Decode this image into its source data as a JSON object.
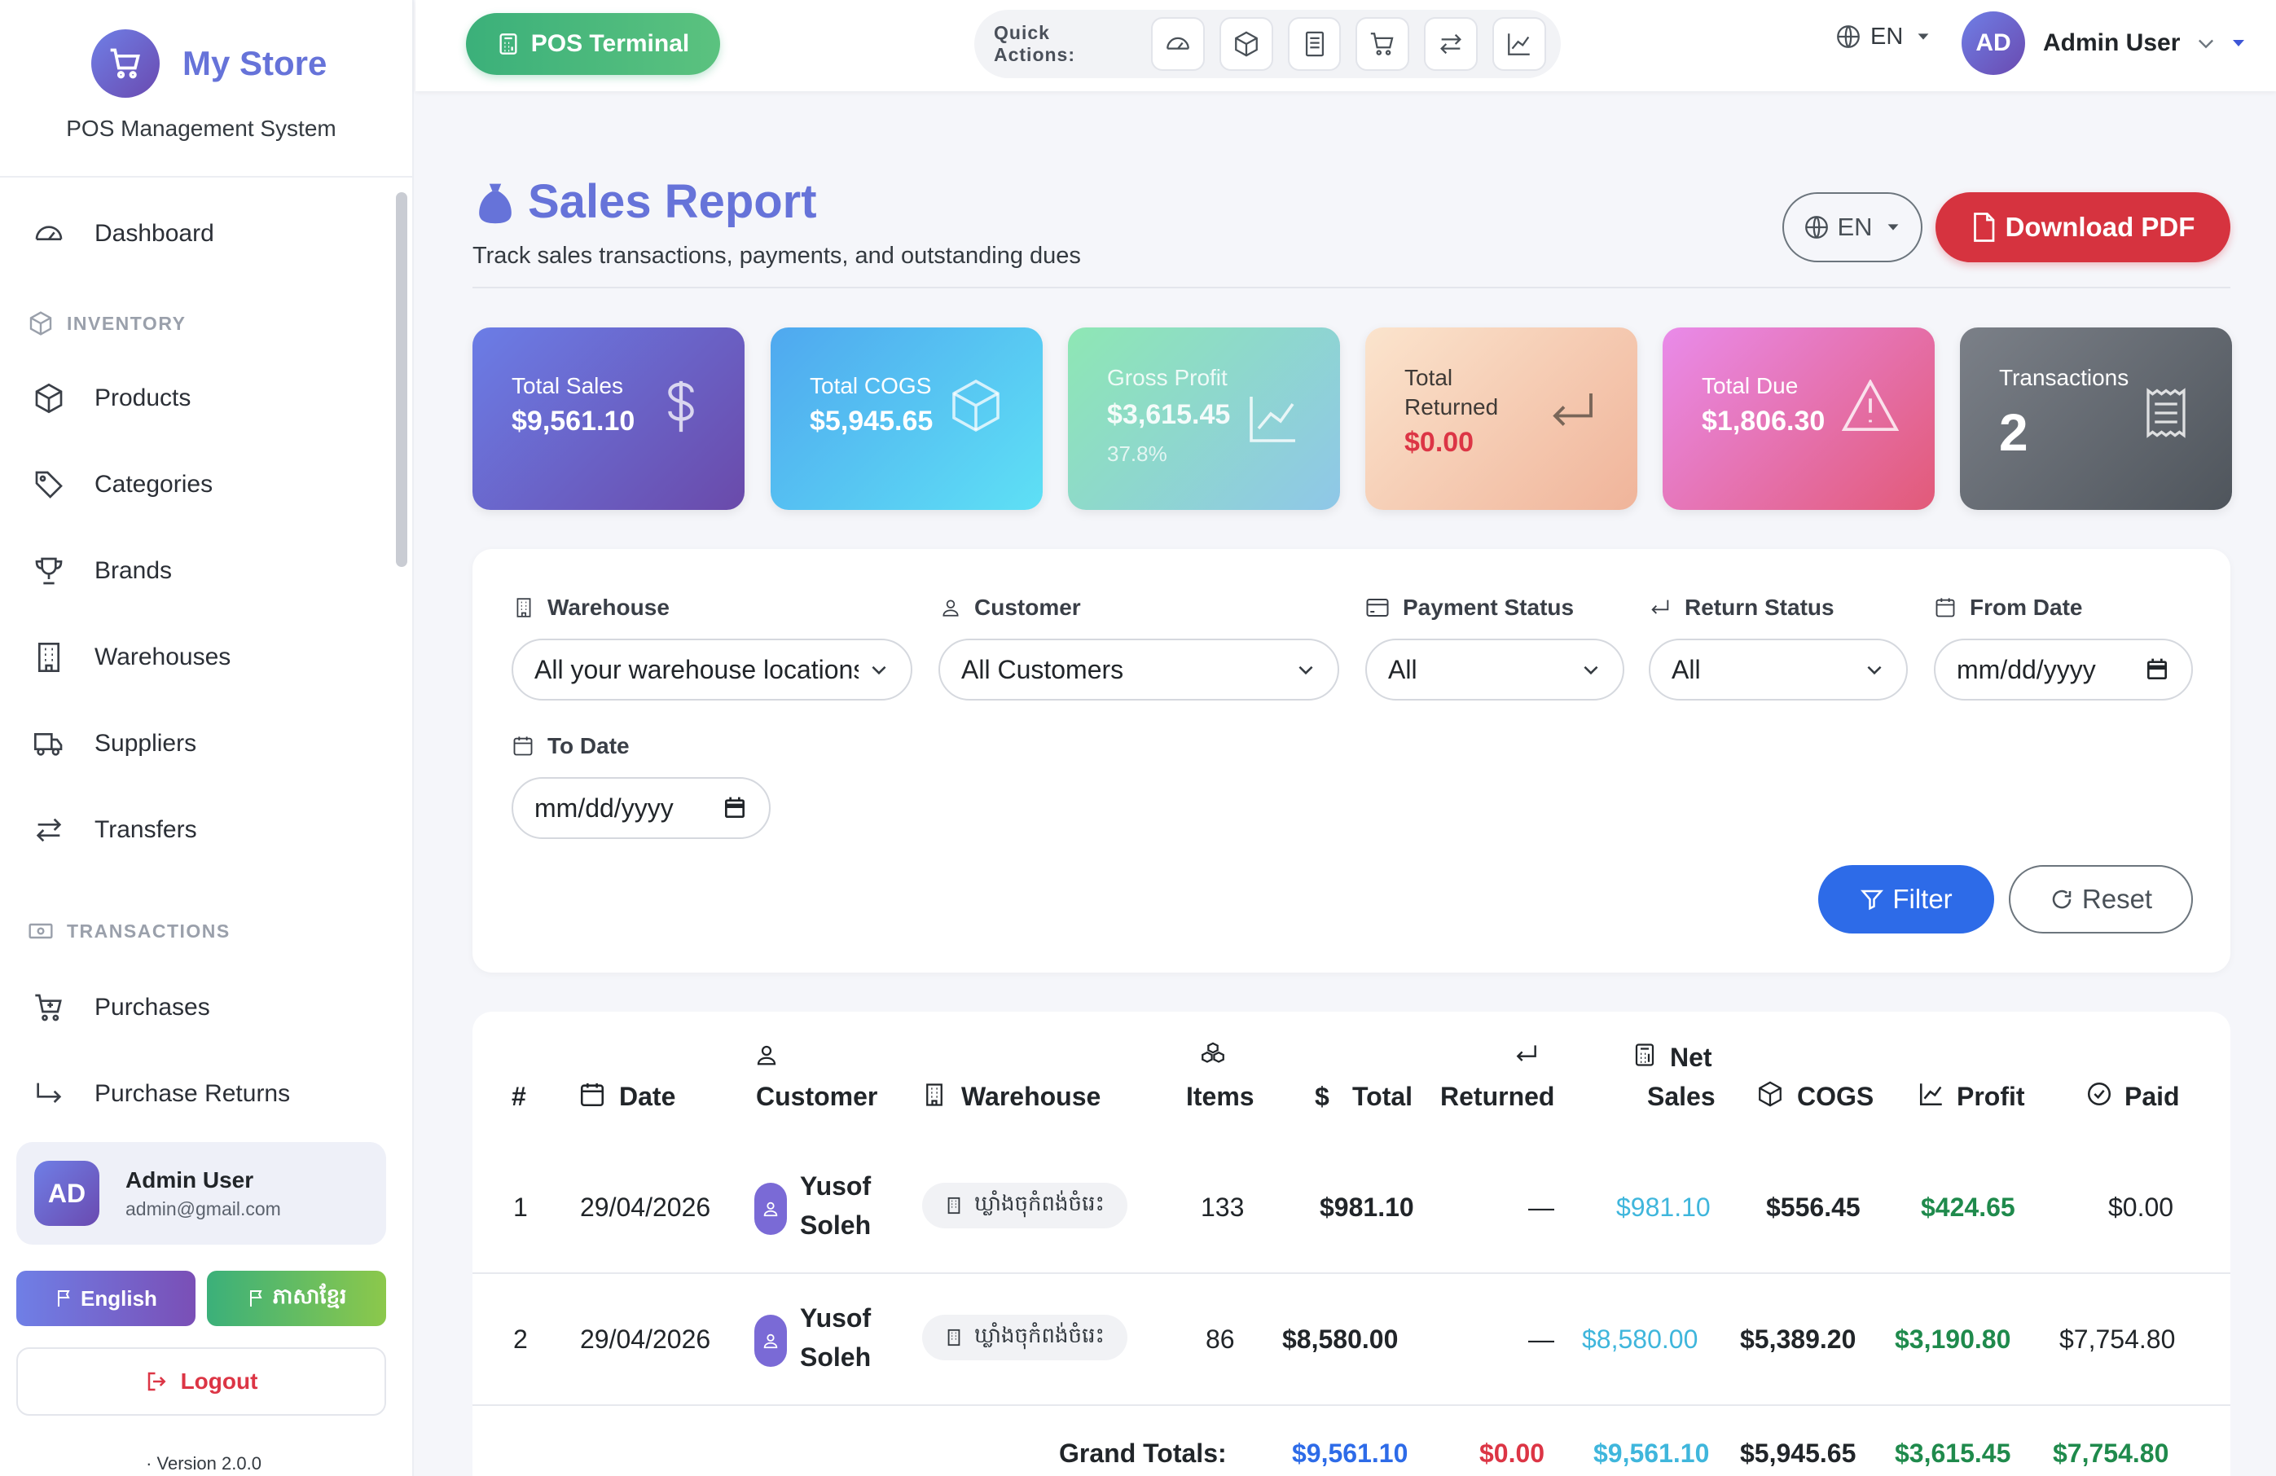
{
  "sidebar": {
    "brand_name": "My Store",
    "brand_sub": "POS Management System",
    "items": {
      "dashboard": "Dashboard",
      "section_inventory": "INVENTORY",
      "products": "Products",
      "categories": "Categories",
      "brands": "Brands",
      "warehouses": "Warehouses",
      "suppliers": "Suppliers",
      "transfers": "Transfers",
      "section_transactions": "TRANSACTIONS",
      "purchases": "Purchases",
      "purchase_returns": "Purchase Returns"
    },
    "user": {
      "initials": "AD",
      "name": "Admin User",
      "email": "admin@gmail.com"
    },
    "lang_en": "English",
    "lang_km": "ភាសាខ្មែរ",
    "logout": "Logout",
    "version": "· Version 2.0.0"
  },
  "topbar": {
    "pos_label": "POS Terminal",
    "quick_actions_label": "Quick Actions:",
    "lang": "EN",
    "user_initials": "AD",
    "user_name": "Admin User"
  },
  "page": {
    "title": "Sales Report",
    "subtitle": "Track sales transactions, payments, and outstanding dues",
    "lang": "EN",
    "download_pdf": "Download PDF"
  },
  "stats": {
    "total_sales": {
      "label": "Total Sales",
      "value": "$9,561.10"
    },
    "total_cogs": {
      "label": "Total COGS",
      "value": "$5,945.65"
    },
    "gross_profit": {
      "label": "Gross Profit",
      "value": "$3,615.45",
      "pct": "37.8%"
    },
    "total_returned": {
      "label_1": "Total",
      "label_2": "Returned",
      "value": "$0.00"
    },
    "total_due": {
      "label": "Total Due",
      "value": "$1,806.30"
    },
    "transactions": {
      "label": "Transactions",
      "value": "2"
    }
  },
  "filters": {
    "warehouse": {
      "label": "Warehouse",
      "value": "All your warehouse locations"
    },
    "customer": {
      "label": "Customer",
      "value": "All Customers"
    },
    "payment_status": {
      "label": "Payment Status",
      "value": "All"
    },
    "return_status": {
      "label": "Return Status",
      "value": "All"
    },
    "from_date": {
      "label": "From Date",
      "placeholder": "mm/dd/yyyy"
    },
    "to_date": {
      "label": "To Date",
      "placeholder": "mm/dd/yyyy"
    },
    "filter_btn": "Filter",
    "reset_btn": "Reset"
  },
  "table": {
    "headers": {
      "num": "#",
      "date": "Date",
      "customer": "Customer",
      "warehouse": "Warehouse",
      "items": "Items",
      "total": "Total",
      "returned": "Returned",
      "net_1": "Net",
      "net_2": "Sales",
      "cogs": "COGS",
      "profit": "Profit",
      "paid": "Paid"
    },
    "rows": [
      {
        "num": "1",
        "date": "29/04/2026",
        "customer_1": "Yusof",
        "customer_2": "Soleh",
        "warehouse": "ឃ្លាំងចុកំពង់ចំរេះ",
        "items": "133",
        "total": "$981.10",
        "returned": "—",
        "net_sales": "$981.10",
        "cogs": "$556.45",
        "profit": "$424.65",
        "paid": "$0.00"
      },
      {
        "num": "2",
        "date": "29/04/2026",
        "customer_1": "Yusof",
        "customer_2": "Soleh",
        "warehouse": "ឃ្លាំងចុកំពង់ចំរេះ",
        "items": "86",
        "total": "$8,580.00",
        "returned": "—",
        "net_sales": "$8,580.00",
        "cogs": "$5,389.20",
        "profit": "$3,190.80",
        "paid": "$7,754.80"
      }
    ],
    "totals": {
      "label": "Grand Totals:",
      "total": "$9,561.10",
      "returned": "$0.00",
      "net_sales": "$9,561.10",
      "cogs": "$5,945.65",
      "profit": "$3,615.45",
      "paid": "$7,754.80"
    }
  }
}
